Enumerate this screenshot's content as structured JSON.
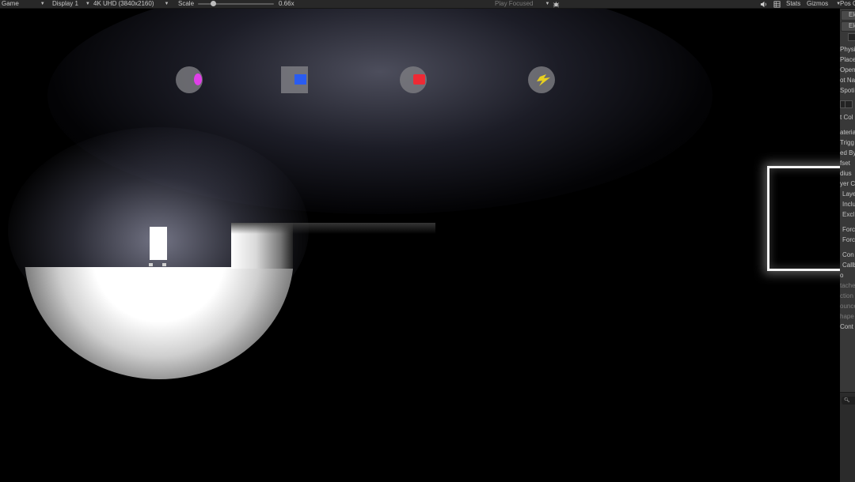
{
  "toolbar": {
    "view_label": "Game",
    "display_label": "Display 1",
    "resolution_label": "4K UHD (3840x2160)",
    "scale_label": "Scale",
    "scale_value_label": "0.66x",
    "scale_fraction": 0.18,
    "play_mode_label": "Play Focused",
    "bug_icon": "bug-icon",
    "audio_icon": "speaker-icon",
    "stats_label": "Stats",
    "gizmos_label": "Gizmos",
    "pos_label": "Pos C"
  },
  "game_view": {
    "icons": [
      {
        "name": "orb-pill-icon",
        "accent": "#e040e8"
      },
      {
        "name": "blue-block-icon",
        "accent": "#2a5cf0"
      },
      {
        "name": "red-block-icon",
        "accent": "#ee2a34"
      },
      {
        "name": "lightning-icon",
        "accent": "#e8d020"
      }
    ]
  },
  "inspector": {
    "rows": [
      "Ele",
      "Ele",
      "Physi",
      "Place",
      "Open",
      "ot Na",
      "Spoti",
      "t Col",
      "ateria",
      "Trigg",
      "ed By",
      "fset",
      "dius",
      "yer C",
      "Laye",
      "Inclu",
      "Excl",
      "Forc",
      "Forc",
      "Con",
      "Callb",
      "o",
      "tache",
      "ction",
      "ounce",
      "hape",
      "Cont"
    ],
    "search_icon": "search-icon"
  }
}
